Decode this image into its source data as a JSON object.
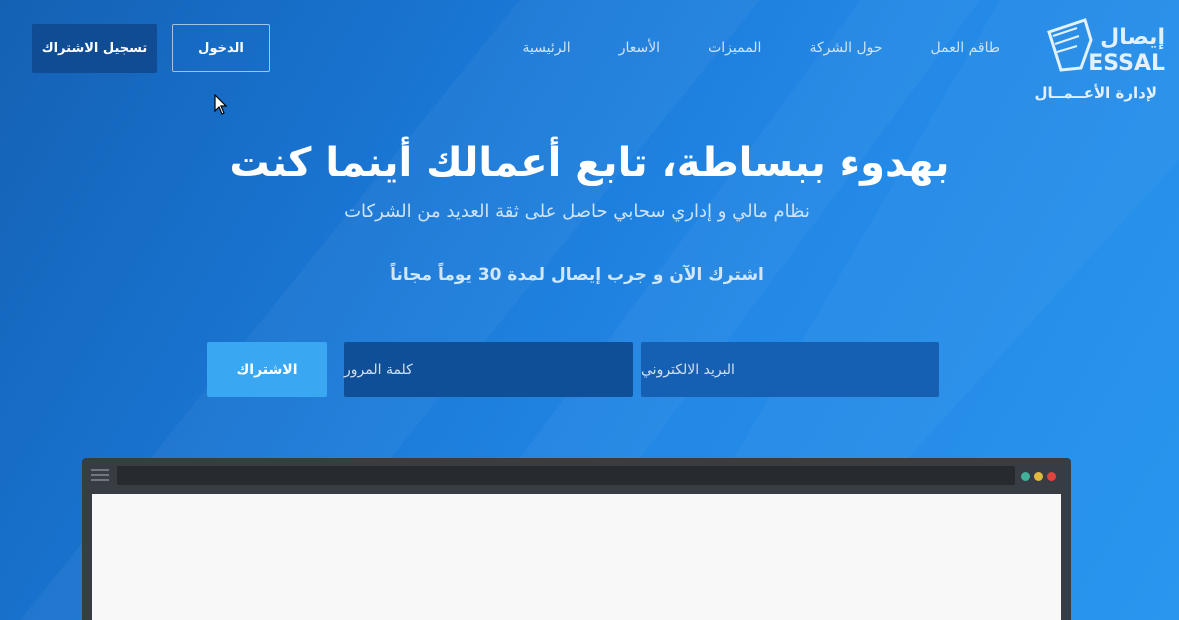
{
  "logo": {
    "brand_arabic": "إيصال",
    "brand_latin": "ESSAL",
    "tagline": "لإدارة الأعــمــال"
  },
  "nav": {
    "items": [
      {
        "label": "الرئيسية"
      },
      {
        "label": "الأسعار"
      },
      {
        "label": "المميزات"
      },
      {
        "label": "حول الشركة"
      },
      {
        "label": "طاقم العمل"
      }
    ]
  },
  "header": {
    "login_label": "الدخول",
    "register_label": "تسجيل الاشتراك"
  },
  "hero": {
    "title": "بهدوء ببساطة، تابع أعمالك أينما كنت",
    "subtitle": "نظام مالي و إداري سحابي حاصل على ثقة العديد من الشركات",
    "cta": "اشترك الآن و جرب إيصال لمدة 30 يوماً مجاناً"
  },
  "signup": {
    "email_placeholder": "البريد الالكتروني",
    "password_placeholder": "كلمة المرور",
    "submit_label": "الاشتراك"
  },
  "colors": {
    "background_start": "#1461b4",
    "background_end": "#2a96ee",
    "register_button": "#0f4c94",
    "subscribe_button": "#3aa7f2",
    "dot_green": "#3fb19b",
    "dot_yellow": "#e2b93b",
    "dot_red": "#e0443e"
  },
  "icons": {
    "logo": "shield-logo-icon",
    "cursor": "mouse-cursor-icon",
    "menu": "hamburger-icon"
  }
}
